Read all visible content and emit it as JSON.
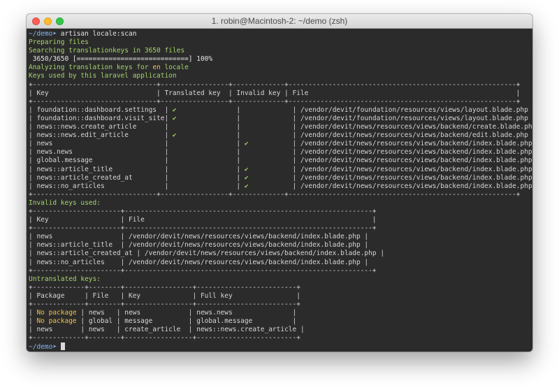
{
  "window": {
    "title": "1. robin@Macintosh-2: ~/demo (zsh)"
  },
  "prompt": "~/demo",
  "command": "artisan locale:scan",
  "status": {
    "preparing": "Preparing files",
    "searching": "Searching translationkeys in 3650 files",
    "progress": " 3650/3650 [============================] 100%",
    "analyzing_prefix": "Analyzing translation keys for ",
    "locale": "en",
    "analyzing_suffix": " locale",
    "keys_used": "Keys used by this laravel application"
  },
  "keys_table": {
    "border": "+-------------------------------+-----------------+-------------+---------------------------------------------------------+",
    "header": "| Key                           | Translated key  | Invalid key | File                                                    |",
    "rows": [
      "| foundation::dashboard.settings  | ✔               |             | /vendor/devit/foundation/resources/views/layout.blade.php   |",
      "| foundation::dashboard.visit_site| ✔               |             | /vendor/devit/foundation/resources/views/layout.blade.php   |",
      "| news::news.create_article       |                 |             | /vendor/devit/news/resources/views/backend/create.blade.php |",
      "| news::news.edit_article         | ✔               |             | /vendor/devit/news/resources/views/backend/edit.blade.php   |",
      "| news                            |                 | ✔           | /vendor/devit/news/resources/views/backend/index.blade.php  |",
      "| news.news                       |                 |             | /vendor/devit/news/resources/views/backend/index.blade.php  |",
      "| global.message                  |                 |             | /vendor/devit/news/resources/views/backend/index.blade.php  |",
      "| news::article_title             |                 | ✔           | /vendor/devit/news/resources/views/backend/index.blade.php  |",
      "| news::article_created_at        |                 | ✔           | /vendor/devit/news/resources/views/backend/index.blade.php  |",
      "| news::no_articles               |                 | ✔           | /vendor/devit/news/resources/views/backend/index.blade.php  |"
    ]
  },
  "invalid_section": {
    "title": "Invalid keys used:",
    "border": "+----------------------+--------------------------------------------------------------+",
    "header": "| Key                  | File                                                         |",
    "rows": [
      "| news                 | /vendor/devit/news/resources/views/backend/index.blade.php |",
      "| news::article_title  | /vendor/devit/news/resources/views/backend/index.blade.php |",
      "| news::article_created_at | /vendor/devit/news/resources/views/backend/index.blade.php |",
      "| news::no_articles    | /vendor/devit/news/resources/views/backend/index.blade.php |"
    ]
  },
  "untranslated_section": {
    "title": "Untranslated keys:",
    "border": "+-------------+--------+-----------------+-------------------------+",
    "header": "| Package     | File   | Key             | Full key                |",
    "rows": [
      {
        "package": "No package",
        "rest": " | news   | news            | news.news               |",
        "pkg_highlight": true
      },
      {
        "package": "No package",
        "rest": " | global | message         | global.message          |",
        "pkg_highlight": true
      },
      {
        "package": "news      ",
        "rest": " | news   | create_article  | news::news.create_article |",
        "pkg_highlight": false
      }
    ]
  },
  "colors": {
    "background": "#2b2b2b",
    "text": "#d6d6d6",
    "prompt": "#86b4f0",
    "status_green": "#a6d46c",
    "highlight_yellow": "#f2c04c",
    "check_green": "#9ed55a"
  }
}
